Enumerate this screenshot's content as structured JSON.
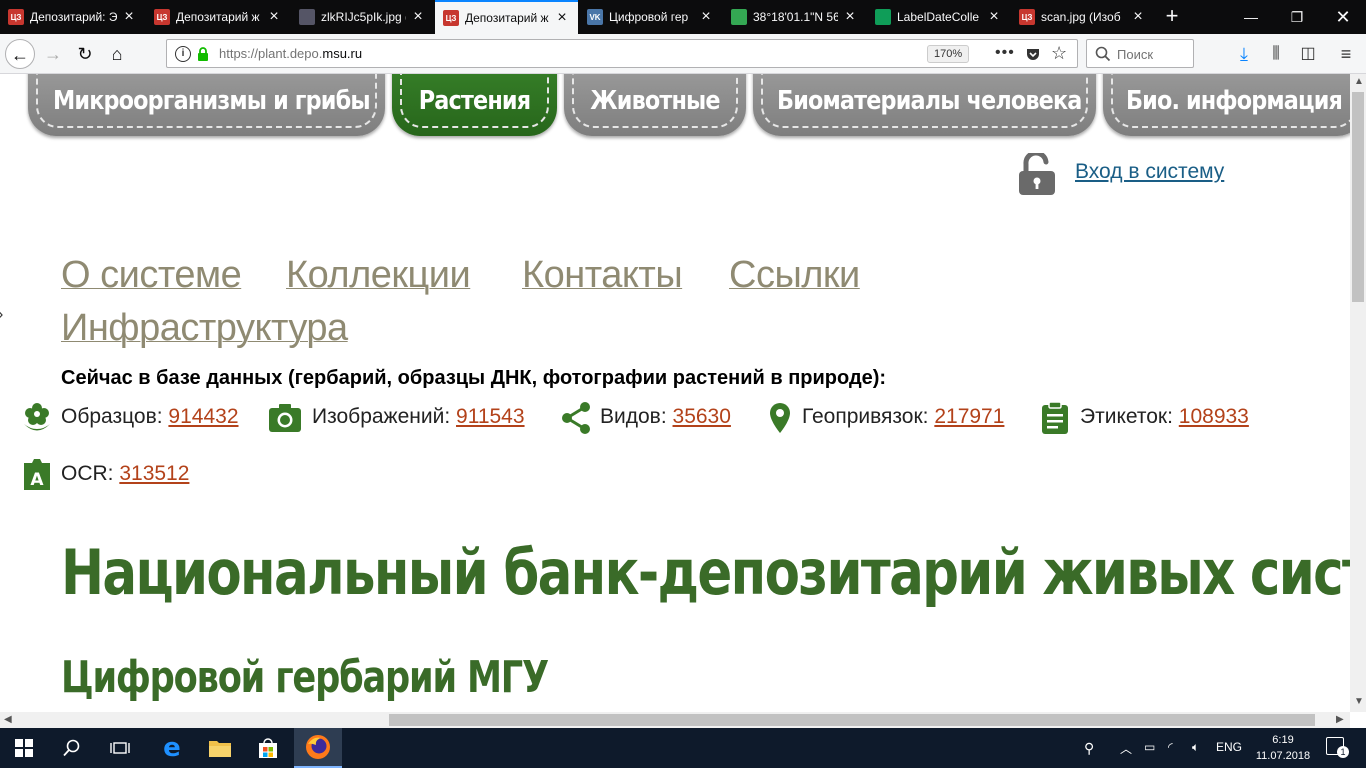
{
  "browser": {
    "tabs": [
      {
        "title": "Депозитарий: Э",
        "favicon": "ЦЗ",
        "color": "#c7372f"
      },
      {
        "title": "Депозитарий ж",
        "favicon": "ЦЗ",
        "color": "#c7372f"
      },
      {
        "title": "zlkRIJc5pIk.jpg (",
        "favicon": "img",
        "color": "#556"
      },
      {
        "title": "Депозитарий ж",
        "favicon": "ЦЗ",
        "color": "#c7372f"
      },
      {
        "title": "Цифровой гер",
        "favicon": "VK",
        "color": "#4a76a8"
      },
      {
        "title": "38°18'01.1\"N 56",
        "favicon": "map",
        "color": "#34a853"
      },
      {
        "title": "LabelDateColle",
        "favicon": "sheet",
        "color": "#0f9d58"
      },
      {
        "title": "scan.jpg (Изоб",
        "favicon": "ЦЗ",
        "color": "#c7372f"
      }
    ],
    "active_tab_index": 3,
    "url_prefix": "https://plant.depo.",
    "url_domain": "msu.ru",
    "zoom": "170%",
    "search_placeholder": "Поиск",
    "page_actions": "•••"
  },
  "site": {
    "categories": [
      {
        "label": "Микроорганизмы и грибы",
        "active": false
      },
      {
        "label": "Растения",
        "active": true
      },
      {
        "label": "Животные",
        "active": false
      },
      {
        "label": "Биоматериалы человека",
        "active": false
      },
      {
        "label": "Био. информация",
        "active": false
      }
    ],
    "login_label": "Вход в систему",
    "menu": [
      "О системе",
      "Коллекции",
      "Контакты",
      "Ссылки",
      "Инфраструктура"
    ],
    "db_heading": "Сейчас в базе данных (гербарий, образцы ДНК, фотографии растений в природе):",
    "stats": [
      {
        "label": "Образцов:",
        "value": "914432",
        "icon": "flower-icon"
      },
      {
        "label": "Изображений:",
        "value": "911543",
        "icon": "camera-icon"
      },
      {
        "label": "Видов:",
        "value": "35630",
        "icon": "share-icon"
      },
      {
        "label": "Геопривязок:",
        "value": "217971",
        "icon": "map-pin-icon"
      },
      {
        "label": "Этикеток:",
        "value": "108933",
        "icon": "clipboard-icon"
      },
      {
        "label": "OCR:",
        "value": "313512",
        "icon": "ocr-icon"
      }
    ],
    "title": "Национальный банк-депозитарий живых систем",
    "subtitle": "Цифровой гербарий МГУ",
    "accent_green": "#3a6b28",
    "link_color": "#b3421a"
  },
  "taskbar": {
    "language": "ENG",
    "time": "6:19",
    "date": "11.07.2018",
    "notifications": "1"
  }
}
